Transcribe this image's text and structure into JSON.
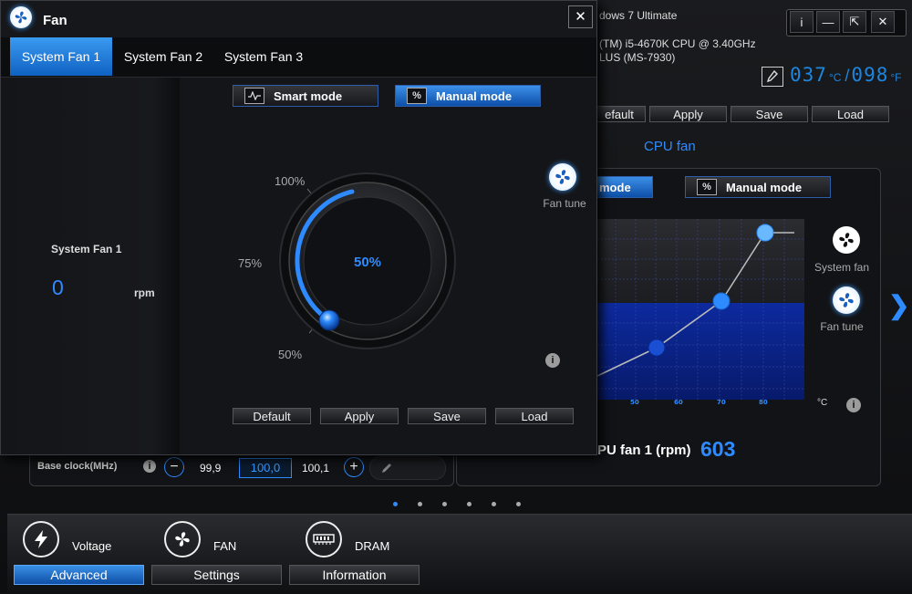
{
  "main": {
    "sysinfo": {
      "os": "dows 7 Ultimate",
      "cpu": "(TM) i5-4670K CPU @ 3.40GHz",
      "board": "LUS (MS-7930)"
    },
    "window_buttons": {
      "info": "i",
      "minimize": "—",
      "restore": "⇱",
      "close": "✕"
    },
    "temps": {
      "c_value": "037",
      "c_unit": "°C",
      "f_value": "098",
      "f_unit": "°F"
    },
    "actions": {
      "default": "efault",
      "apply": "Apply",
      "save": "Save",
      "load": "Load"
    },
    "cpu_fan": {
      "title": "CPU fan",
      "smart_mode": "mode",
      "manual_mode": "Manual mode",
      "manual_icon": "%",
      "x_ticks": [
        "50",
        "60",
        "70",
        "80"
      ],
      "x_unit": "°C",
      "readout_label": "PU fan 1 (rpm)",
      "readout_value": "603",
      "system_fan_label": "System fan",
      "fan_tune_label": "Fan tune"
    },
    "base_clock": {
      "label": "Base clock(MHz)",
      "minus": "−",
      "low": "99,9",
      "current": "100,0",
      "high": "100,1",
      "plus": "+"
    },
    "bottom_nav": {
      "voltage": "Voltage",
      "fan": "FAN",
      "dram": "DRAM",
      "tabs": [
        "Advanced",
        "Settings",
        "Information"
      ]
    },
    "page_dots": 6,
    "next_arrow": "❯"
  },
  "fan_dialog": {
    "title": "Fan",
    "close": "✕",
    "tabs": [
      "System Fan 1",
      "System Fan 2",
      "System Fan 3"
    ],
    "active_tab": 0,
    "readout": {
      "label": "System Fan 1",
      "value": "0",
      "unit": "rpm"
    },
    "modes": {
      "smart": "Smart mode",
      "manual": "Manual mode",
      "manual_icon": "%"
    },
    "dial": {
      "value_text": "50%",
      "level": 50,
      "ticks": [
        "100%",
        "75%",
        "50%"
      ]
    },
    "fan_tune_label": "Fan tune",
    "actions": {
      "default": "Default",
      "apply": "Apply",
      "save": "Save",
      "load": "Load"
    }
  },
  "colors": {
    "accent": "#2e8bff",
    "active_tab": "#1a76d8",
    "bg": "#121316"
  }
}
